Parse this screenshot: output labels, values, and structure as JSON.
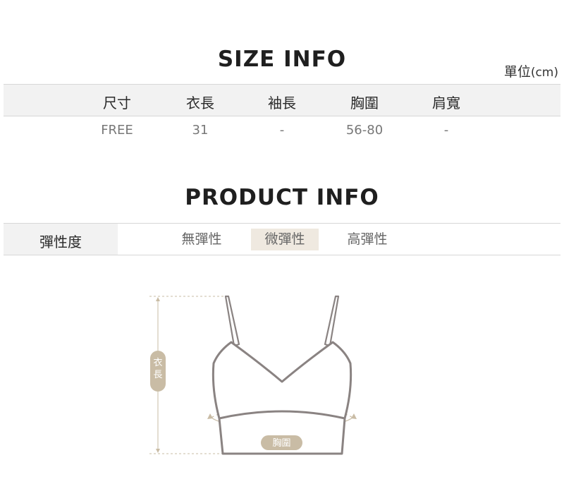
{
  "size_info": {
    "title": "SIZE INFO",
    "unit_main": "單位",
    "unit_paren": "(cm)",
    "headers": [
      "尺寸",
      "衣長",
      "袖長",
      "胸圍",
      "肩寬"
    ],
    "values": [
      "FREE",
      "31",
      "-",
      "56-80",
      "-"
    ]
  },
  "product_info": {
    "title": "PRODUCT INFO",
    "elasticity_label": "彈性度",
    "options": [
      "無彈性",
      "微彈性",
      "高彈性"
    ],
    "selected": "微彈性"
  },
  "diagram": {
    "length_label": "衣長",
    "chest_label": "胸圍",
    "garment_color": "#8a8382",
    "accent_color": "#c9bca5"
  }
}
